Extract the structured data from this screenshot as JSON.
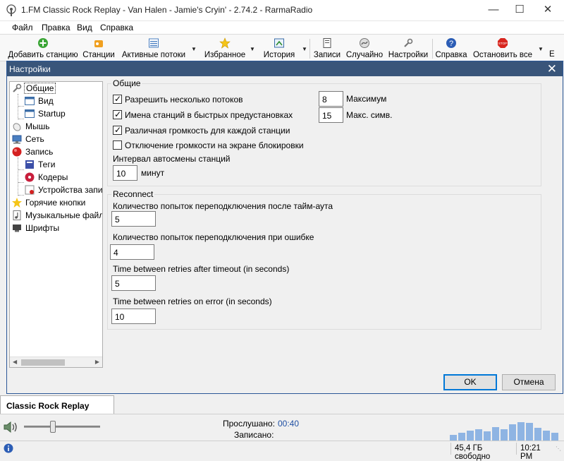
{
  "window": {
    "title": "1.FM Classic Rock Replay - Van Halen - Jamie's Cryin' - 2.74.2 - RarmaRadio",
    "minimize_icon": "minimize-icon",
    "maximize_icon": "maximize-icon",
    "close_icon": "close-icon"
  },
  "menu": [
    "Файл",
    "Правка",
    "Вид",
    "Справка"
  ],
  "toolbar": {
    "add_station": "Добавить станцию",
    "stations": "Станции",
    "active_streams": "Активные потоки",
    "favorites": "Избранное",
    "history": "История",
    "records": "Записи",
    "random": "Случайно",
    "settings": "Настройки",
    "help": "Справка",
    "stop_all": "Остановить все",
    "overflow": "E"
  },
  "dialog": {
    "title": "Настройки",
    "ok": "OK",
    "cancel": "Отмена"
  },
  "tree": [
    {
      "label": "Общие",
      "icon": "wrench-icon"
    },
    {
      "label": "Вид",
      "icon": "window-icon"
    },
    {
      "label": "Startup",
      "icon": "window-icon"
    },
    {
      "label": "Мышь",
      "icon": "mouse-icon"
    },
    {
      "label": "Сеть",
      "icon": "network-icon"
    },
    {
      "label": "Запись",
      "icon": "record-icon"
    },
    {
      "label": "Теги",
      "icon": "tag-icon"
    },
    {
      "label": "Кодеры",
      "icon": "encoder-icon"
    },
    {
      "label": "Устройства запи",
      "icon": "device-icon"
    },
    {
      "label": "Горячие кнопки",
      "icon": "hotkey-icon"
    },
    {
      "label": "Музыкальные файл",
      "icon": "music-file-icon"
    },
    {
      "label": "Шрифты",
      "icon": "font-icon"
    }
  ],
  "general": {
    "group_title": "Общие",
    "allow_multiple_streams": {
      "label": "Разрешить несколько потоков",
      "checked": true
    },
    "station_names_presets": {
      "label": "Имена станций в быстрых предустановках",
      "checked": true
    },
    "volume_per_station": {
      "label": "Различная громкость для каждой станции",
      "checked": true
    },
    "mute_on_lock": {
      "label": "Отключение громкости на экране блокировки",
      "checked": false
    },
    "max_label": "Максимум",
    "max_value": "8",
    "max_chars_label": "Макс. симв.",
    "max_chars_value": "15",
    "auto_switch_label": "Интервал автосмены станций",
    "auto_switch_value": "10",
    "auto_switch_unit": "минут"
  },
  "reconnect": {
    "group_title": "Reconnect",
    "timeout_attempts_label": "Количество попыток переподключения после тайм-аута",
    "timeout_attempts_value": "5",
    "error_attempts_label": "Количество попыток переподключения при ошибке",
    "error_attempts_value": "4",
    "time_after_timeout_label": "Time between retries after timeout (in seconds)",
    "time_after_timeout_value": "5",
    "time_on_error_label": "Time between retries on error (in seconds)",
    "time_on_error_value": "10"
  },
  "station_tab": "Classic Rock Replay",
  "player": {
    "listened_label": "Прослушано:",
    "listened_value": "00:40",
    "recorded_label": "Записано:",
    "recorded_value": "",
    "volume_level": 0.38,
    "equalizer_levels": [
      0.25,
      0.35,
      0.45,
      0.5,
      0.4,
      0.6,
      0.5,
      0.7,
      0.8,
      0.75,
      0.55,
      0.45,
      0.35
    ]
  },
  "status": {
    "free_space": "45,4 ГБ свободно",
    "time": "10:21 PM"
  },
  "colors": {
    "accent": "#0078d7",
    "dialog_title_bg": "#39557a",
    "equalizer": "#8eb4e3",
    "time_value": "#1f4fa3"
  }
}
